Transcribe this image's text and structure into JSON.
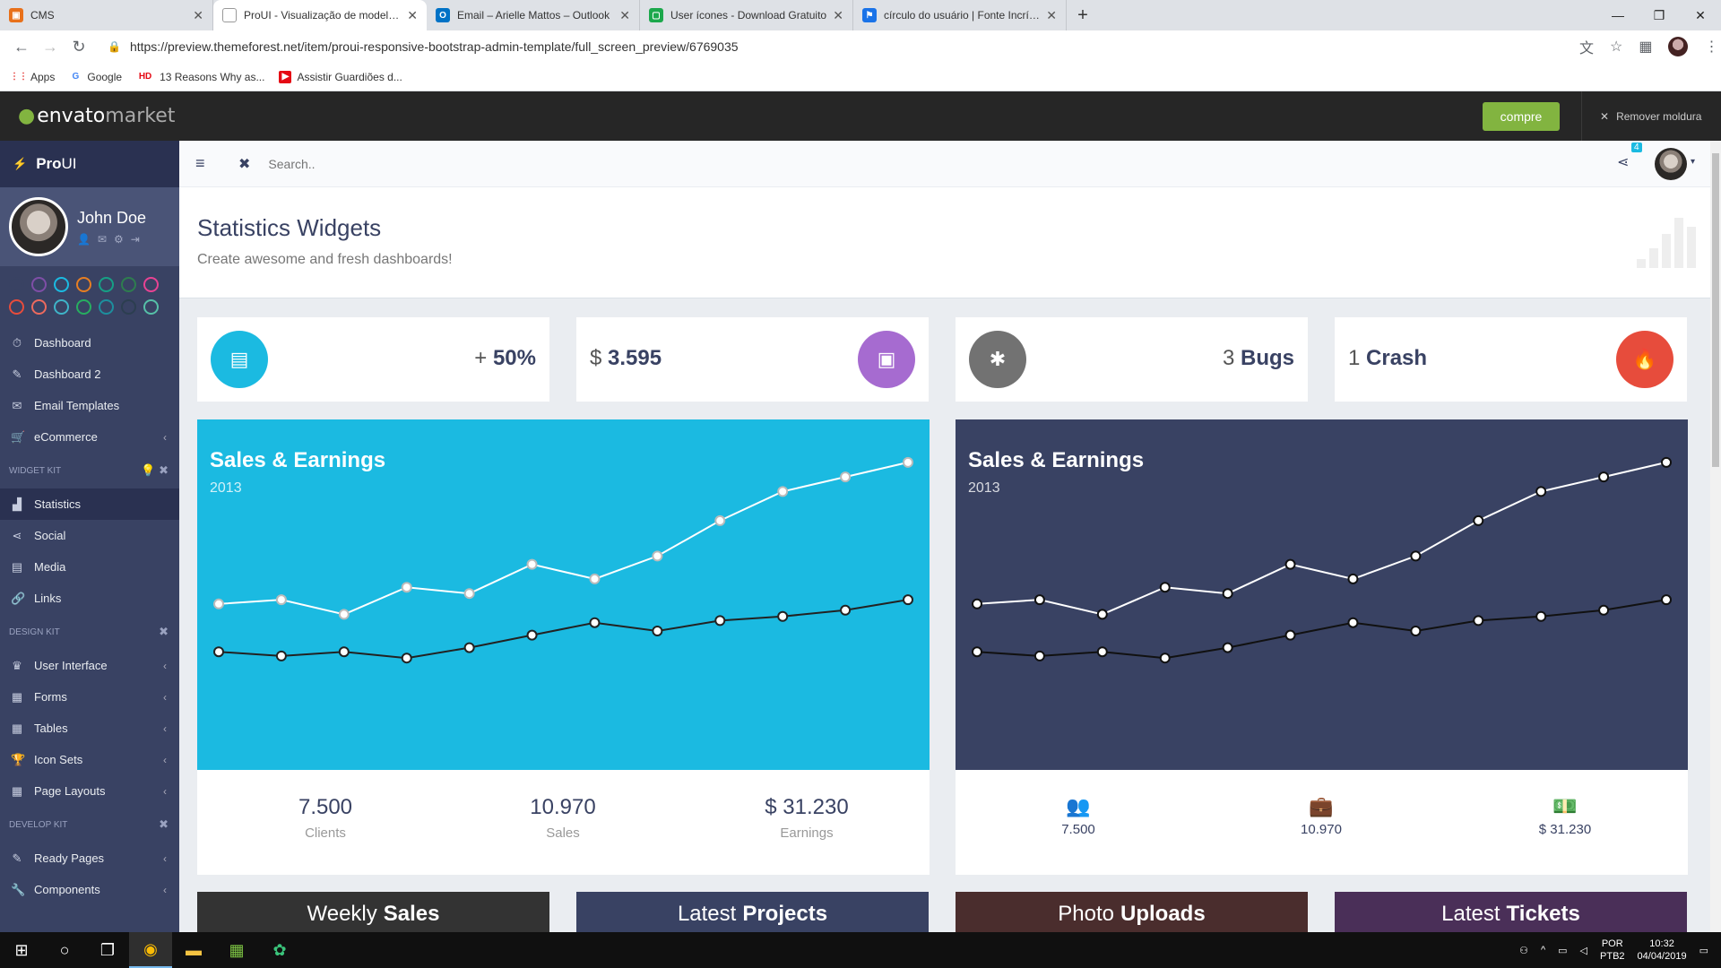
{
  "browser": {
    "tabs": [
      {
        "title": "CMS",
        "color": "#e8701a"
      },
      {
        "title": "ProUI - Visualização de modelo d",
        "color": "#ffffff",
        "active": true
      },
      {
        "title": "Email – Arielle Mattos – Outlook",
        "color": "#0072c6"
      },
      {
        "title": "User ícones - Download Gratuito",
        "color": "#1ca84c"
      },
      {
        "title": "círculo do usuário | Fonte Incrível",
        "color": "#1a73e8"
      }
    ],
    "url": "https://preview.themeforest.net/item/proui-responsive-bootstrap-admin-template/full_screen_preview/6769035",
    "bookmarks": [
      {
        "label": "Apps",
        "color": "#e53935"
      },
      {
        "label": "Google",
        "color": "#4285f4"
      },
      {
        "label": "13 Reasons Why as...",
        "color": "#e50914"
      },
      {
        "label": "Assistir Guardiões d...",
        "color": "#e50914"
      }
    ]
  },
  "envato": {
    "logo_main": "envato",
    "logo_sub": "market",
    "buy_label": "compre",
    "remove_label": "Remover moldura"
  },
  "sidebar": {
    "brand_bold": "Pro",
    "brand_rest": "UI",
    "user_name": "John Doe",
    "theme_colors": [
      "#394263",
      "#7e4ea6",
      "#1bbae1",
      "#e67e22",
      "#16a085",
      "#2e7d4f",
      "#e84393",
      "#e74c3c",
      "#ec6a5e",
      "#3fb4c8",
      "#27ae60",
      "#1d8f9e",
      "#2c3e50",
      "#56c0a8"
    ],
    "items": [
      {
        "label": "Dashboard",
        "icon": "⏱"
      },
      {
        "label": "Dashboard 2",
        "icon": "✎"
      },
      {
        "label": "Email Templates",
        "icon": "✉"
      },
      {
        "label": "eCommerce",
        "icon": "🛒",
        "chevron": "‹"
      }
    ],
    "section_widget": "Widget Kit",
    "widget_items": [
      {
        "label": "Statistics",
        "icon": "▟",
        "active": true
      },
      {
        "label": "Social",
        "icon": "⋖"
      },
      {
        "label": "Media",
        "icon": "▤"
      },
      {
        "label": "Links",
        "icon": "🔗"
      }
    ],
    "section_design": "Design Kit",
    "design_items": [
      {
        "label": "User Interface",
        "icon": "♛",
        "chevron": "‹"
      },
      {
        "label": "Forms",
        "icon": "▦",
        "chevron": "‹"
      },
      {
        "label": "Tables",
        "icon": "▦",
        "chevron": "‹"
      },
      {
        "label": "Icon Sets",
        "icon": "🏆",
        "chevron": "‹"
      },
      {
        "label": "Page Layouts",
        "icon": "▦",
        "chevron": "‹"
      }
    ],
    "section_develop": "Develop Kit",
    "develop_items": [
      {
        "label": "Ready Pages",
        "icon": "✎",
        "chevron": "‹"
      },
      {
        "label": "Components",
        "icon": "🔧",
        "chevron": "‹"
      }
    ]
  },
  "topbar": {
    "search_placeholder": "Search..",
    "notification_count": "4"
  },
  "page": {
    "title": "Statistics Widgets",
    "subtitle": "Create awesome and fresh dashboards!"
  },
  "mini_widgets": [
    {
      "prefix": "+ ",
      "value": "50%",
      "icon": "▤",
      "color": "#1bbae1"
    },
    {
      "prefix": "$ ",
      "value": "3.595",
      "icon": "▣",
      "color": "#a66bd0"
    },
    {
      "prefix": "3 ",
      "value": "Bugs",
      "icon": "✱",
      "color": "#727272"
    },
    {
      "prefix": "1 ",
      "value": "Crash",
      "icon": "🔥",
      "color": "#e74c3c"
    }
  ],
  "panels": [
    {
      "title": "Sales & Earnings",
      "year": "2013",
      "bg": "#1bbae1",
      "stats": [
        {
          "value": "7.500",
          "label": "Clients"
        },
        {
          "value": "10.970",
          "label": "Sales"
        },
        {
          "value": "$ 31.230",
          "label": "Earnings"
        }
      ]
    },
    {
      "title": "Sales & Earnings",
      "year": "2013",
      "bg": "#394263",
      "stats": [
        {
          "value": "7.500",
          "icon": "👥"
        },
        {
          "value": "10.970",
          "icon": "💼"
        },
        {
          "value": "$ 31.230",
          "icon": "💵"
        }
      ]
    }
  ],
  "chart_data": {
    "type": "line",
    "x": [
      1,
      2,
      3,
      4,
      5,
      6,
      7,
      8,
      9,
      10,
      11,
      12
    ],
    "series": [
      {
        "values": [
          75,
          77,
          70,
          83,
          80,
          94,
          87,
          98,
          115,
          129,
          136,
          143
        ]
      },
      {
        "values": [
          52,
          50,
          52,
          49,
          54,
          60,
          66,
          62,
          67,
          69,
          72,
          77
        ]
      }
    ],
    "ylim": [
      0,
      155
    ]
  },
  "bottom_widgets": [
    {
      "pre": "Weekly",
      "bold": "Sales",
      "bg": "#333333"
    },
    {
      "pre": "Latest",
      "bold": "Projects",
      "bg": "#394263"
    },
    {
      "pre": "Photo",
      "bold": "Uploads",
      "bg": "#4a2d2d"
    },
    {
      "pre": "Latest",
      "bold": "Tickets",
      "bg": "#4a2f58"
    }
  ],
  "taskbar": {
    "lang_top": "POR",
    "lang_bottom": "PTB2",
    "time": "10:32",
    "date": "04/04/2019"
  }
}
